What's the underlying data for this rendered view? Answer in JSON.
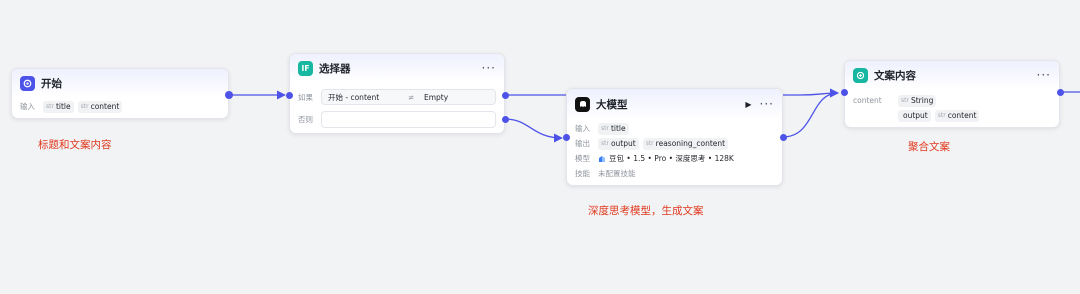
{
  "start_node": {
    "title": "开始",
    "input_label": "输入",
    "params": [
      {
        "type": "str",
        "name": "title"
      },
      {
        "type": "str",
        "name": "content"
      }
    ]
  },
  "selector_node": {
    "title": "选择器",
    "icon_text": "IF",
    "if_label": "如果",
    "condition_left": "开始 - content",
    "condition_operator": "≠",
    "condition_right": "Empty",
    "else_label": "否则"
  },
  "llm_node": {
    "title": "大模型",
    "input_label": "输入",
    "inputs": [
      {
        "type": "str",
        "name": "title"
      }
    ],
    "output_label": "输出",
    "outputs": [
      {
        "type": "str",
        "name": "output"
      },
      {
        "type": "str",
        "name": "reasoning_content"
      }
    ],
    "model_label": "模型",
    "model_value": "豆包 • 1.5 • Pro • 深度思考 • 128K",
    "skill_label": "技能",
    "skill_value": "未配置技能"
  },
  "content_node": {
    "title": "文案内容",
    "content_label": "content",
    "params": [
      {
        "type": "str",
        "name": "String"
      },
      {
        "type": "",
        "name": "output"
      },
      {
        "type": "str",
        "name": "content"
      }
    ]
  },
  "annotations": {
    "start": "标题和文案内容",
    "llm": "深度思考模型，生成文案",
    "merge": "聚合文案"
  },
  "colors": {
    "edge": "#4d53e8",
    "start_icon": "#4d53e8",
    "selector_icon": "#17b7a1",
    "llm_icon": "#111111",
    "content_icon": "#17b7a1",
    "annotation": "#e0391e"
  }
}
